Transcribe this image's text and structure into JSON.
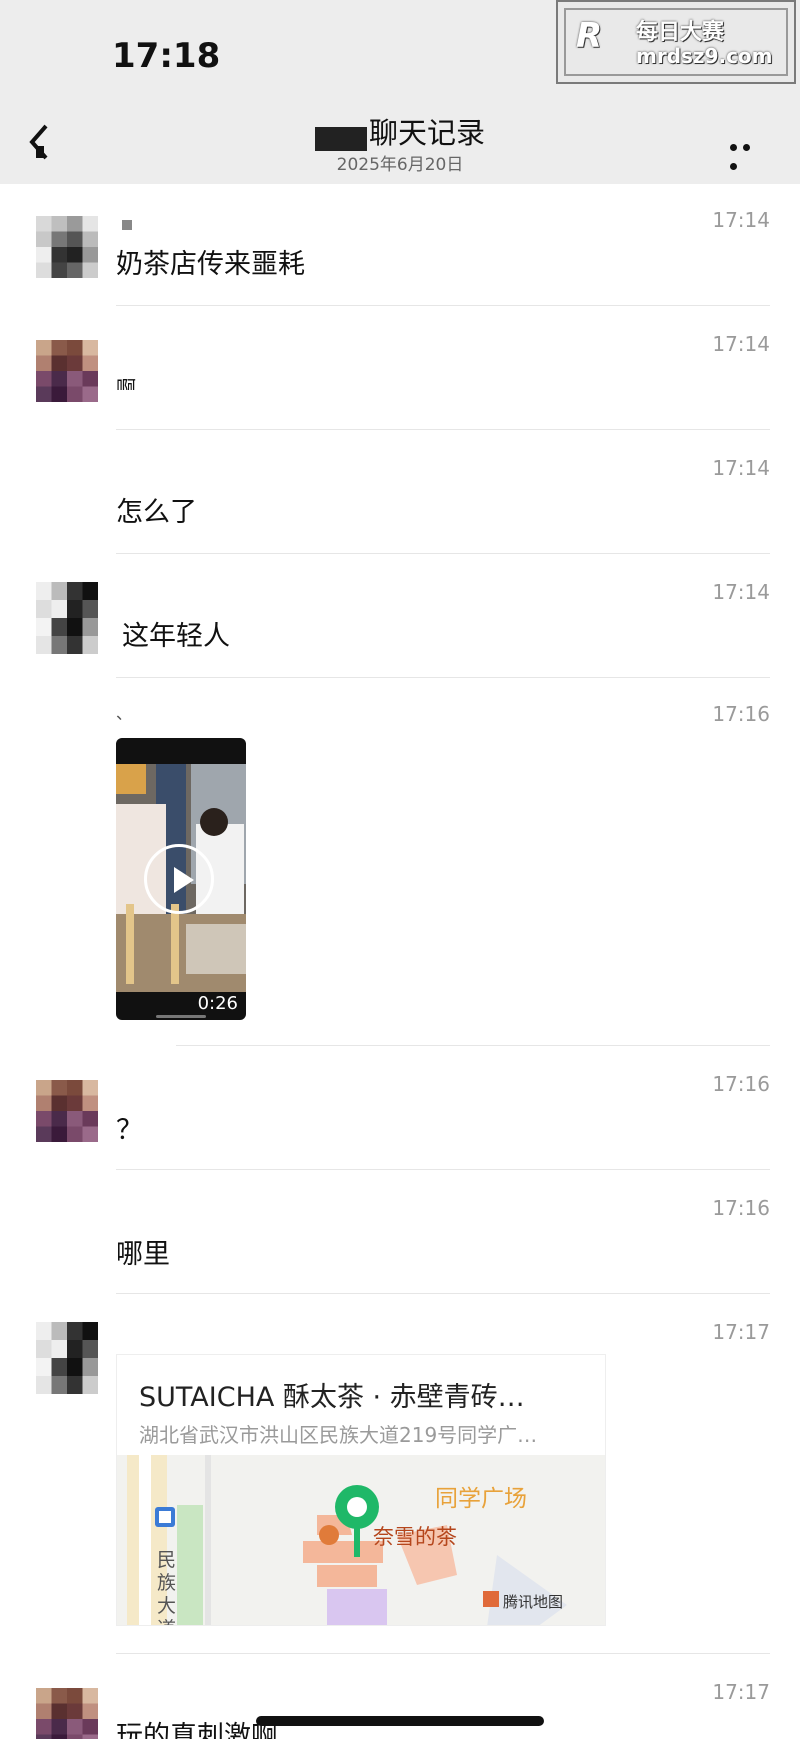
{
  "status": {
    "time": "17:18"
  },
  "watermark": {
    "logo": "R",
    "text_cn": "每日大赛",
    "url": "mrdsz9.com"
  },
  "nav": {
    "title": "聊天记录",
    "date": "2025年6月20日"
  },
  "messages": [
    {
      "time": "17:14",
      "text": "奶茶店传来噩耗"
    },
    {
      "time": "17:14",
      "text": "啊"
    },
    {
      "time": "17:14",
      "text": "怎么了"
    },
    {
      "time": "17:14",
      "text": "这年轻人"
    },
    {
      "time": "17:16",
      "prefix": "、",
      "video_duration": "0:26"
    },
    {
      "time": "17:16",
      "text": "？"
    },
    {
      "time": "17:16",
      "text": "哪里"
    },
    {
      "time": "17:17",
      "location": {
        "title": "SUTAICHA 酥太茶 · 赤壁青砖…",
        "address": "湖北省武汉市洪山区民族大道219号同学广…",
        "map_labels": {
          "plaza": "同学广场",
          "shop": "奈雪的茶",
          "road": "民族大道",
          "provider": "腾讯地图"
        }
      }
    },
    {
      "time": "17:17",
      "text": "玩的真刺激啊"
    }
  ],
  "colors": {
    "background": "#ffffff",
    "bar": "#ededed",
    "time_gray": "#9a9a9a",
    "pin_green": "#1fb868",
    "map_orange": "#e8a23a"
  }
}
